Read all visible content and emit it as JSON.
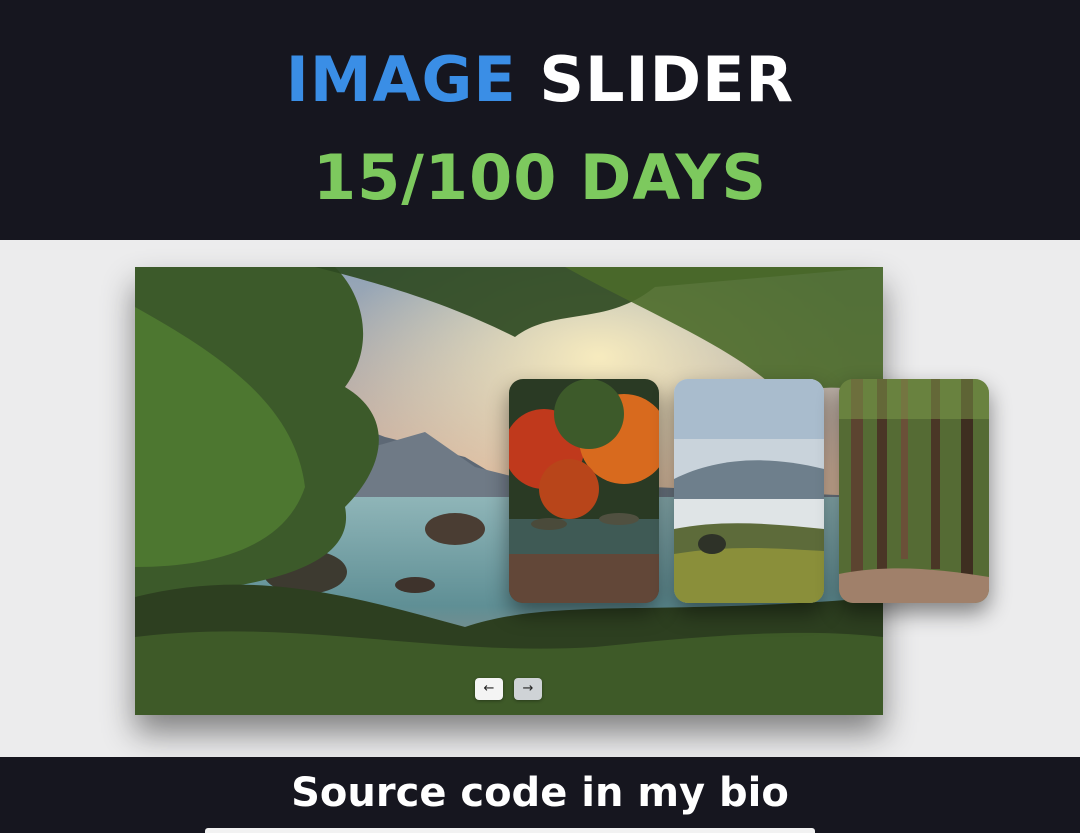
{
  "header": {
    "title_accent": "IMAGE",
    "title_rest": "SLIDER",
    "subtitle": "15/100 DAYS"
  },
  "slider": {
    "main_image": "lake-forest-sunrise",
    "thumbnails": [
      "autumn-river",
      "misty-meadow",
      "pine-forest-path"
    ],
    "prev_icon": "←",
    "next_icon": "→"
  },
  "footer": {
    "text": "Source code in my bio"
  },
  "colors": {
    "header_bg": "#16161f",
    "accent_blue": "#3a8ee6",
    "accent_green": "#7dc95e",
    "page_bg": "#ececed"
  }
}
